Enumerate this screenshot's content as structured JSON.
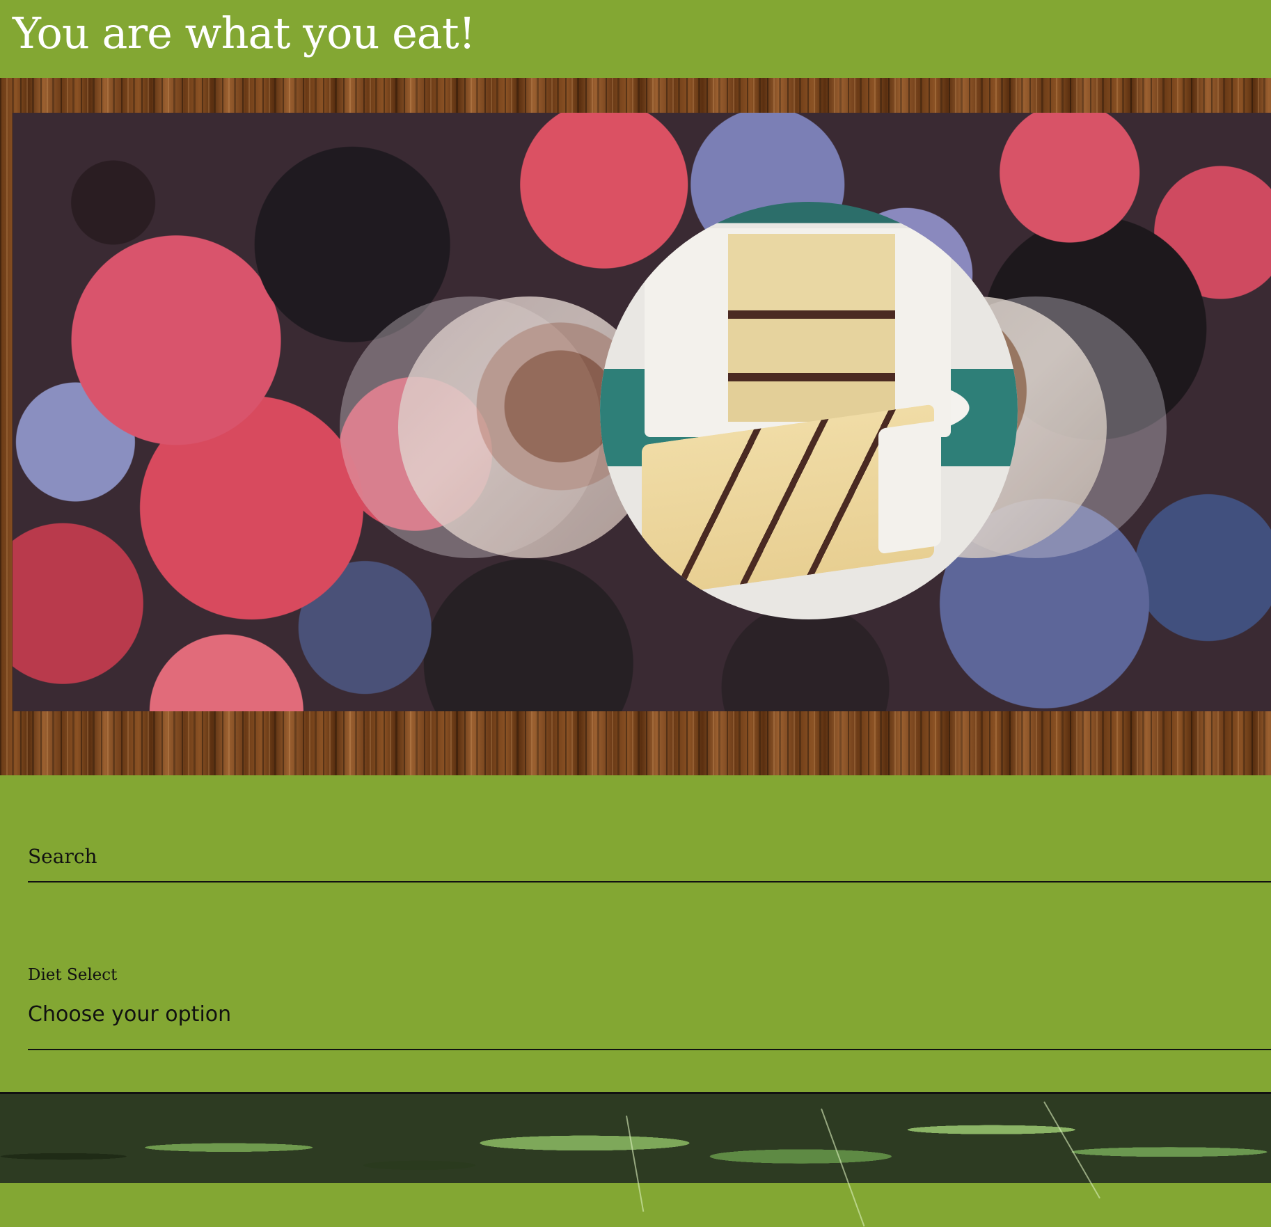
{
  "header": {
    "title": "You are what you eat!"
  },
  "hero": {
    "carousel_images": [
      "soup-bowl-image",
      "layer-cake-image",
      "steak-dish-image"
    ]
  },
  "form": {
    "search_label": "Search",
    "diet_label": "Diet Select",
    "diet_value": "Choose your option"
  },
  "colors": {
    "brand_green": "#83a733",
    "header_text": "#ffffff",
    "form_text": "#111111"
  }
}
